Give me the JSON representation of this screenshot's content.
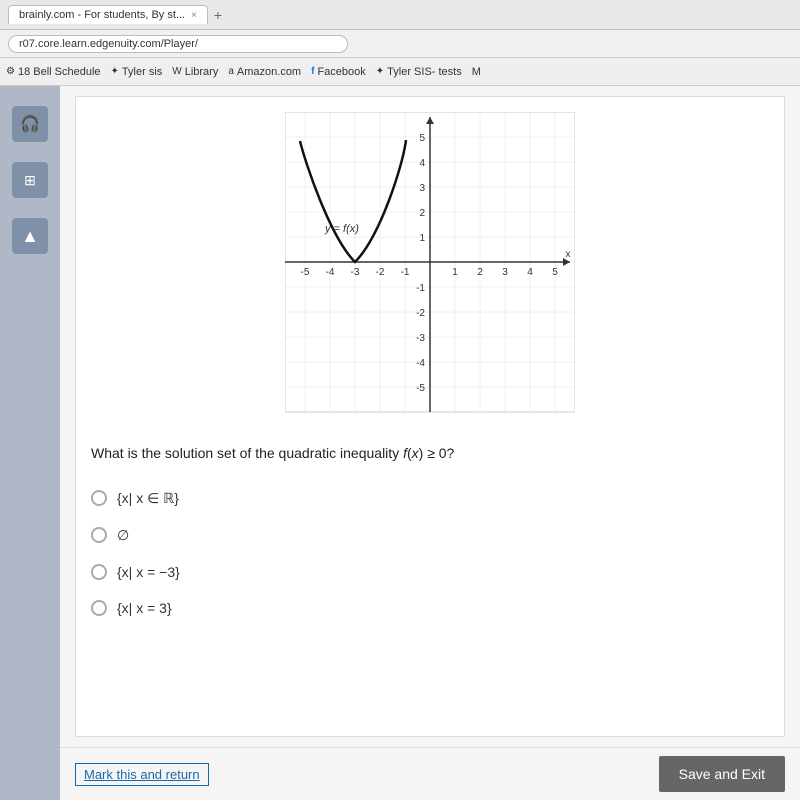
{
  "browser": {
    "tab_label": "brainly.com - For students, By st...",
    "tab_close": "×",
    "add_tab": "+",
    "address": "r07.core.learn.edgenuity.com/Player/"
  },
  "bookmarks": [
    {
      "label": "18 Bell Schedule",
      "icon": "⚙"
    },
    {
      "label": "Tyler sis",
      "icon": "✦"
    },
    {
      "label": "Library",
      "icon": "W"
    },
    {
      "label": "Amazon.com",
      "icon": "a"
    },
    {
      "label": "Facebook",
      "icon": "f"
    },
    {
      "label": "Tyler SIS- tests",
      "icon": "✦"
    },
    {
      "label": "M",
      "icon": ""
    }
  ],
  "sidebar": {
    "headphones_icon": "🎧",
    "calculator_icon": "⊞",
    "up_arrow_icon": "▲"
  },
  "question": {
    "text": "What is the solution set of the quadratic inequality f(x) ≥ 0?",
    "choices": [
      {
        "id": "a",
        "label": "{x| x ∈ ℝ}"
      },
      {
        "id": "b",
        "label": "∅"
      },
      {
        "id": "c",
        "label": "{x| x = −3}"
      },
      {
        "id": "d",
        "label": "{x| x = 3}"
      }
    ]
  },
  "graph": {
    "label": "y = f(x)",
    "x_axis_label": "x",
    "x_ticks": [
      "-5",
      "-4",
      "-3",
      "-2",
      "-1",
      "1",
      "2",
      "3",
      "4",
      "5"
    ],
    "y_ticks": [
      "-5",
      "-4",
      "-3",
      "-2",
      "-1",
      "1",
      "2",
      "3",
      "4",
      "5"
    ]
  },
  "footer": {
    "mark_label": "Mark this and return",
    "save_exit_label": "Save and Exit"
  }
}
